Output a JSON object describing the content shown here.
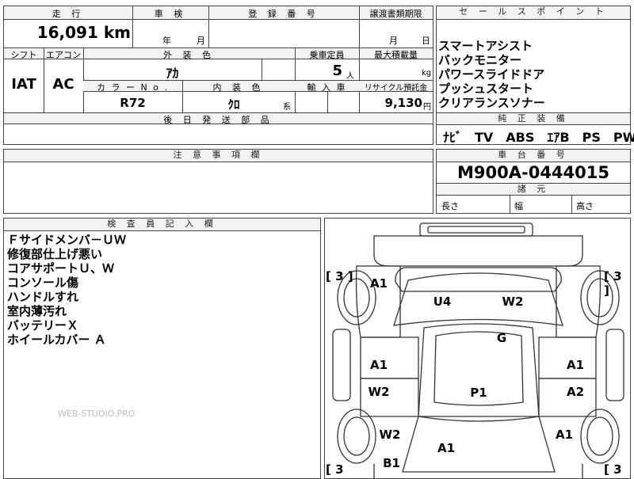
{
  "info_table": {
    "headers": {
      "mileage": "走 行",
      "inspection": "車 検",
      "registration": "登 録 番 号",
      "transfer_deadline": "譲渡書類期限",
      "shift": "シフト",
      "aircon": "エアコン",
      "exterior_color": "外 装 色",
      "capacity": "乗車定員",
      "max_load": "最大積載量",
      "color_no": "カ ラ ー N o .",
      "interior_color": "内 装 色",
      "import": "輸 入 車",
      "recycle_fee": "リサイクル預託金",
      "later_parts": "後 日 発 送 部 品"
    },
    "values": {
      "mileage": "16,091",
      "mileage_unit": "km",
      "inspection_year_unit": "年",
      "inspection_month_unit": "月",
      "transfer_month_unit": "月",
      "transfer_day_unit": "日",
      "shift": "IAT",
      "aircon": "AC",
      "exterior_color": "ｱｶ",
      "capacity": "5",
      "capacity_unit": "人",
      "max_load_unit": "kg",
      "color_no": "R72",
      "interior_color": "ｸﾛ",
      "interior_suffix": "系",
      "recycle_fee": "9,130",
      "recycle_unit": "円"
    }
  },
  "sales_points": {
    "header": "セ ー ル ス ポ イ ン ト",
    "items": [
      "スマートアシスト",
      "バックモニター",
      "パワースライドドア",
      "プッシュスタート",
      "クリアランスソナー"
    ]
  },
  "standard_equipment": {
    "header": "純 正 装 備",
    "value": "ﾅﾋﾞ　TV　ABS　ｴｱB　PS　PW"
  },
  "notes": {
    "header": "注 意 事 項 欄"
  },
  "chassis": {
    "header": "車 台 番 号",
    "value": "M900A-0444015",
    "spec_header": "諸 元",
    "length_label": "長さ",
    "width_label": "幅",
    "height_label": "高さ"
  },
  "inspector": {
    "header": "検 査 員 記 入 欄",
    "items": [
      "Ｆサイドメンバ－ＵＷ",
      "修復部仕上げ悪い",
      "コアサポートＵ、Ｗ",
      "コンソール傷",
      "ハンドルすれ",
      "室内薄汚れ",
      "バッテリーＸ",
      "ホイールカバー Ａ"
    ],
    "watermark": "WEB-STUDIO.PRO"
  },
  "diagram": {
    "marks": [
      {
        "id": "front-left-fender",
        "text": "A1"
      },
      {
        "id": "windshield-left",
        "text": "U4"
      },
      {
        "id": "windshield-right",
        "text": "W2"
      },
      {
        "id": "glass-roof-front",
        "text": "G"
      },
      {
        "id": "left-front-door",
        "text": "A1"
      },
      {
        "id": "right-front-door",
        "text": "A1"
      },
      {
        "id": "left-rear-door",
        "text": "W2"
      },
      {
        "id": "right-rear-door",
        "text": "A2"
      },
      {
        "id": "roof",
        "text": "P1"
      },
      {
        "id": "left-rear-quarter",
        "text": "W2"
      },
      {
        "id": "right-rear-quarter",
        "text": "A1"
      },
      {
        "id": "rear-gate",
        "text": "A1"
      },
      {
        "id": "rear-bumper-left",
        "text": "B1"
      }
    ],
    "brackets": [
      {
        "id": "front-left-tire",
        "text": "[ 3 ]"
      },
      {
        "id": "front-right-tire",
        "text": "[ 3 ]"
      },
      {
        "id": "rear-left-tire",
        "text": "[ 3"
      },
      {
        "id": "rear-right-tire",
        "text": "[ 3"
      }
    ]
  }
}
